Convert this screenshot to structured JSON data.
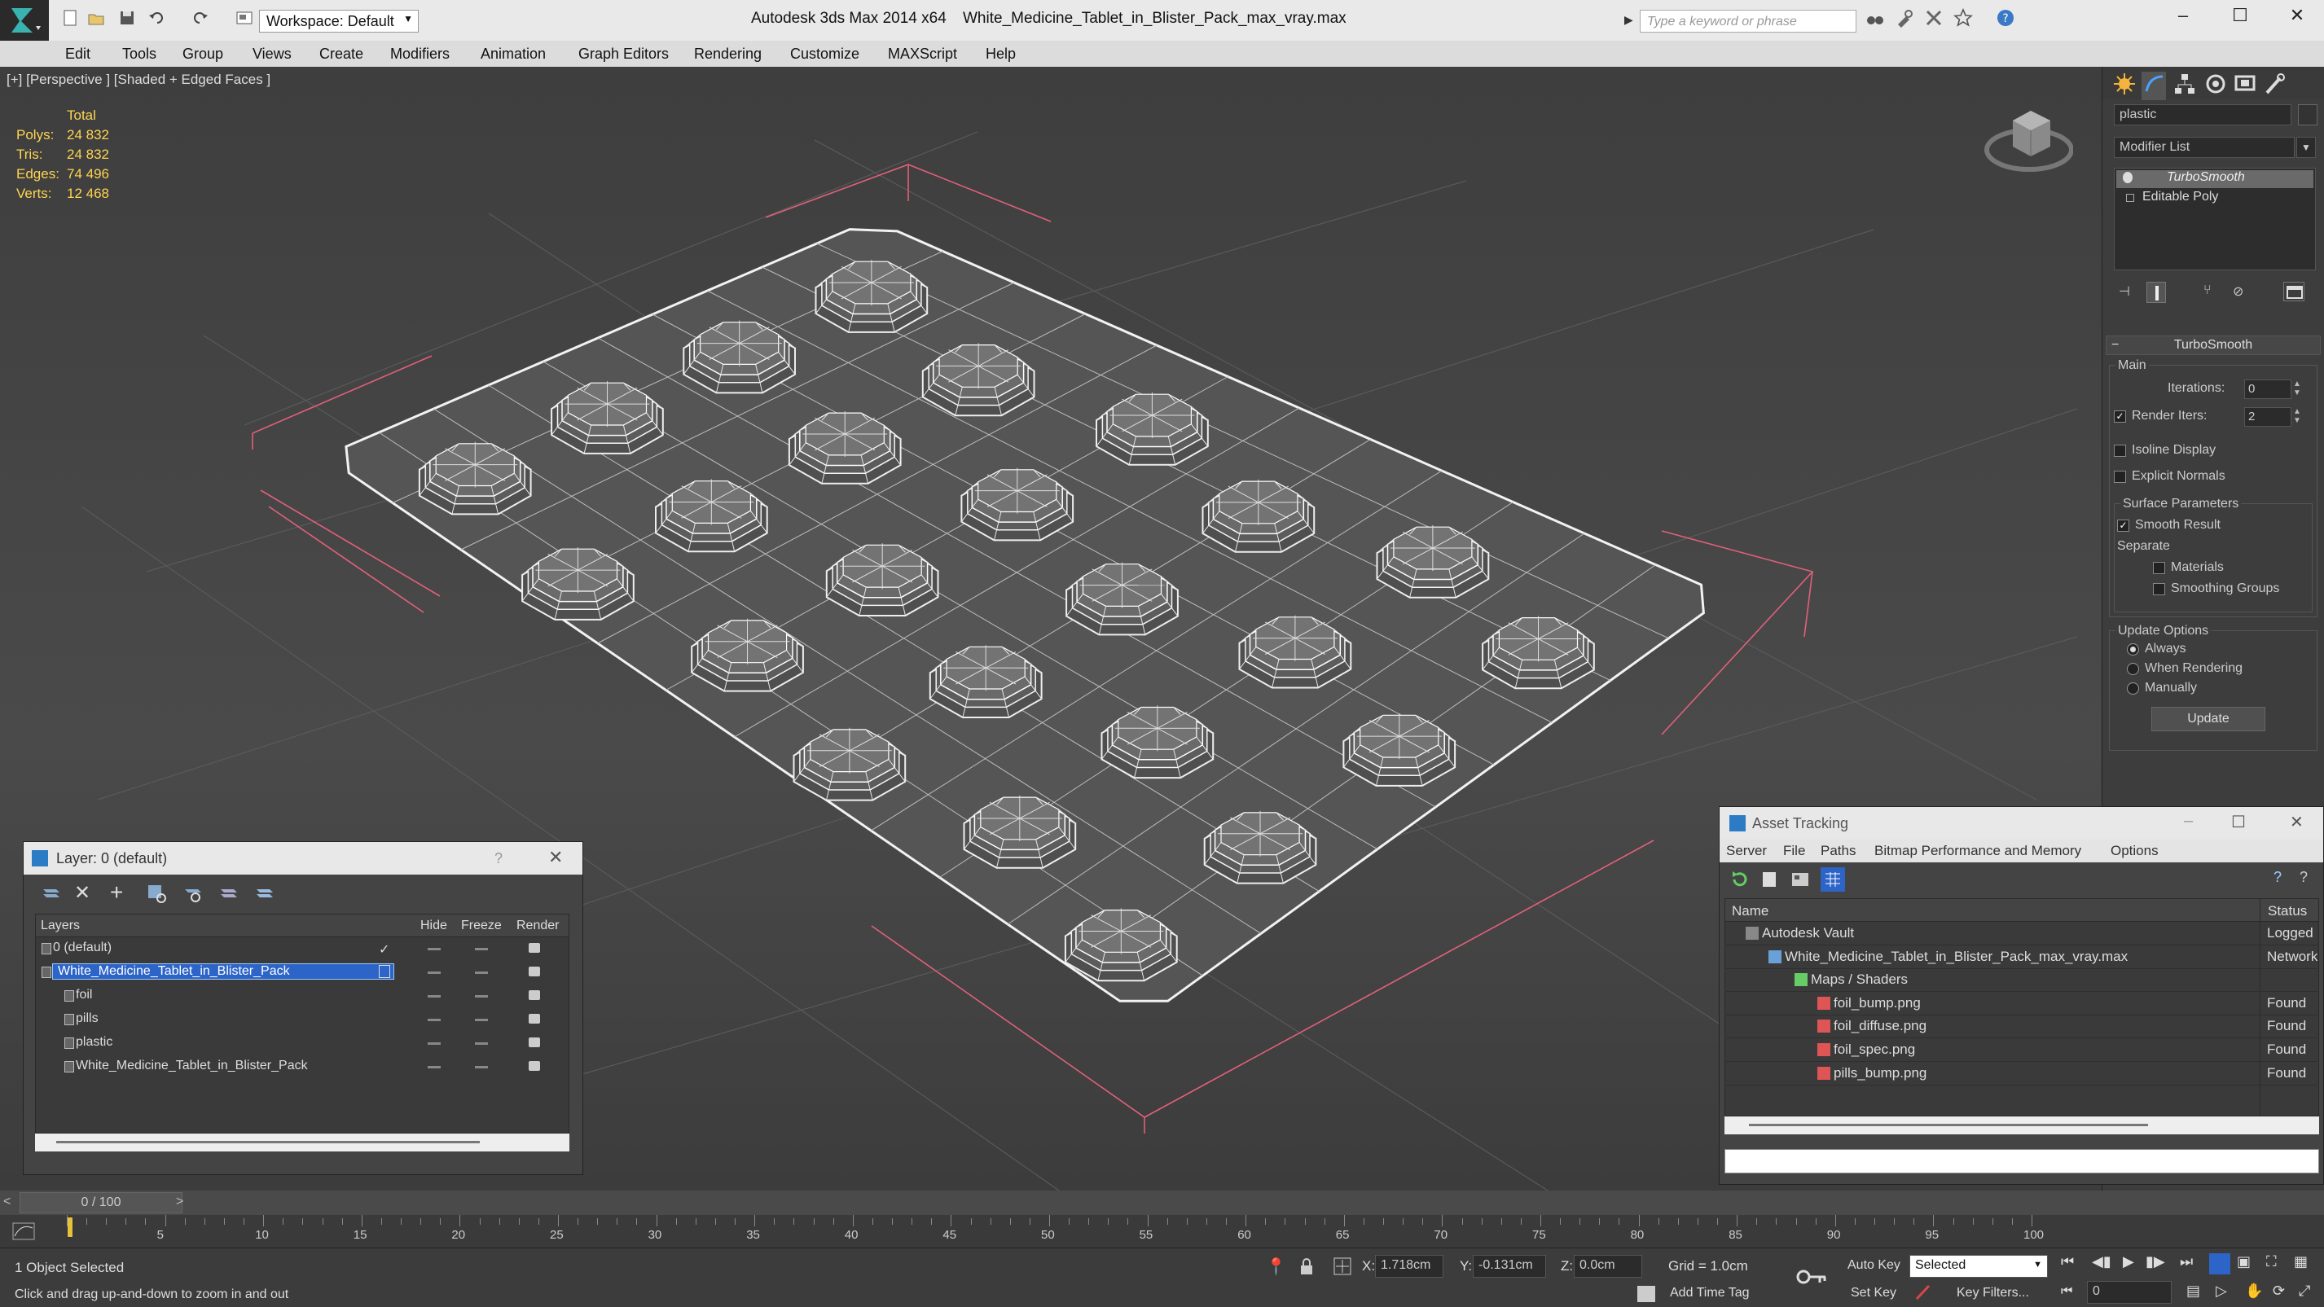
{
  "titlebar": {
    "app_title": "Autodesk 3ds Max  2014 x64",
    "file_name": "White_Medicine_Tablet_in_Blister_Pack_max_vray.max",
    "workspace_label": "Workspace: Default",
    "search_placeholder": "Type a keyword or phrase"
  },
  "menubar": {
    "items": [
      "Edit",
      "Tools",
      "Group",
      "Views",
      "Create",
      "Modifiers",
      "Animation",
      "Graph Editors",
      "Rendering",
      "Customize",
      "MAXScript",
      "Help"
    ]
  },
  "viewport": {
    "label": "[+] [Perspective ] [Shaded + Edged Faces ]",
    "stats": {
      "header": "Total",
      "rows": [
        {
          "label": "Polys:",
          "value": "24 832"
        },
        {
          "label": "Tris:",
          "value": "24 832"
        },
        {
          "label": "Edges:",
          "value": "74 496"
        },
        {
          "label": "Verts:",
          "value": "12 468"
        }
      ]
    }
  },
  "command_panel": {
    "object_name": "plastic",
    "modifier_list": "Modifier List",
    "stack": [
      "TurboSmooth",
      "Editable Poly"
    ],
    "rollout_title": "TurboSmooth",
    "main_group": "Main",
    "iterations_label": "Iterations:",
    "iterations_value": "0",
    "render_iters_label": "Render Iters:",
    "render_iters_value": "2",
    "isoline_label": "Isoline Display",
    "explicit_normals_label": "Explicit Normals",
    "surface_group": "Surface Parameters",
    "smooth_result_label": "Smooth Result",
    "separate_label": "Separate",
    "materials_label": "Materials",
    "smoothing_groups_label": "Smoothing Groups",
    "update_options_group": "Update Options",
    "always_label": "Always",
    "when_rendering_label": "When Rendering",
    "manually_label": "Manually",
    "update_button": "Update"
  },
  "layer_dialog": {
    "title": "Layer: 0 (default)",
    "help": "?",
    "columns": [
      "Layers",
      "Hide",
      "Freeze",
      "Render"
    ],
    "rows": [
      {
        "name": "0 (default)",
        "level": 1,
        "active": true,
        "selected": false
      },
      {
        "name": "White_Medicine_Tablet_in_Blister_Pack",
        "level": 1,
        "active": false,
        "selected": true
      },
      {
        "name": "foil",
        "level": 2,
        "active": false,
        "selected": false
      },
      {
        "name": "pills",
        "level": 2,
        "active": false,
        "selected": false
      },
      {
        "name": "plastic",
        "level": 2,
        "active": false,
        "selected": false
      },
      {
        "name": "White_Medicine_Tablet_in_Blister_Pack",
        "level": 2,
        "active": false,
        "selected": false
      }
    ]
  },
  "asset_dialog": {
    "title": "Asset Tracking",
    "menu": [
      "Server",
      "File",
      "Paths",
      "Bitmap Performance and Memory",
      "Options"
    ],
    "columns": [
      "Name",
      "Status"
    ],
    "rows": [
      {
        "name": "Autodesk Vault",
        "status": "Logged O",
        "level": 1
      },
      {
        "name": "White_Medicine_Tablet_in_Blister_Pack_max_vray.max",
        "status": "Network",
        "level": 2
      },
      {
        "name": "Maps / Shaders",
        "status": "",
        "level": 3
      },
      {
        "name": "foil_bump.png",
        "status": "Found",
        "level": 4
      },
      {
        "name": "foil_diffuse.png",
        "status": "Found",
        "level": 4
      },
      {
        "name": "foil_spec.png",
        "status": "Found",
        "level": 4
      },
      {
        "name": "pills_bump.png",
        "status": "Found",
        "level": 4
      }
    ]
  },
  "timeline": {
    "frame_label": "0 / 100",
    "ticks": [
      "5",
      "10",
      "15",
      "20",
      "25",
      "30",
      "35",
      "40",
      "45",
      "50",
      "55",
      "60",
      "65",
      "70",
      "75",
      "80",
      "85",
      "90",
      "95",
      "100"
    ]
  },
  "statusbar": {
    "selection": "1 Object Selected",
    "prompt": "Click and drag up-and-down to zoom in and out",
    "x_label": "X:",
    "x_value": "1.718cm",
    "y_label": "Y:",
    "y_value": "-0.131cm",
    "z_label": "Z:",
    "z_value": "0.0cm",
    "grid": "Grid = 1.0cm",
    "add_time_tag": "Add Time Tag",
    "auto_key": "Auto Key",
    "set_key": "Set Key",
    "selected_option": "Selected",
    "key_filters": "Key Filters...",
    "frame_value": "0"
  },
  "colors": {
    "accent_blue": "#2d64c8",
    "viewport_bg": "#444444",
    "wire": "#f2f2f2",
    "stats_yellow": "#ffd54f",
    "bbox_pink": "#e0607a"
  }
}
